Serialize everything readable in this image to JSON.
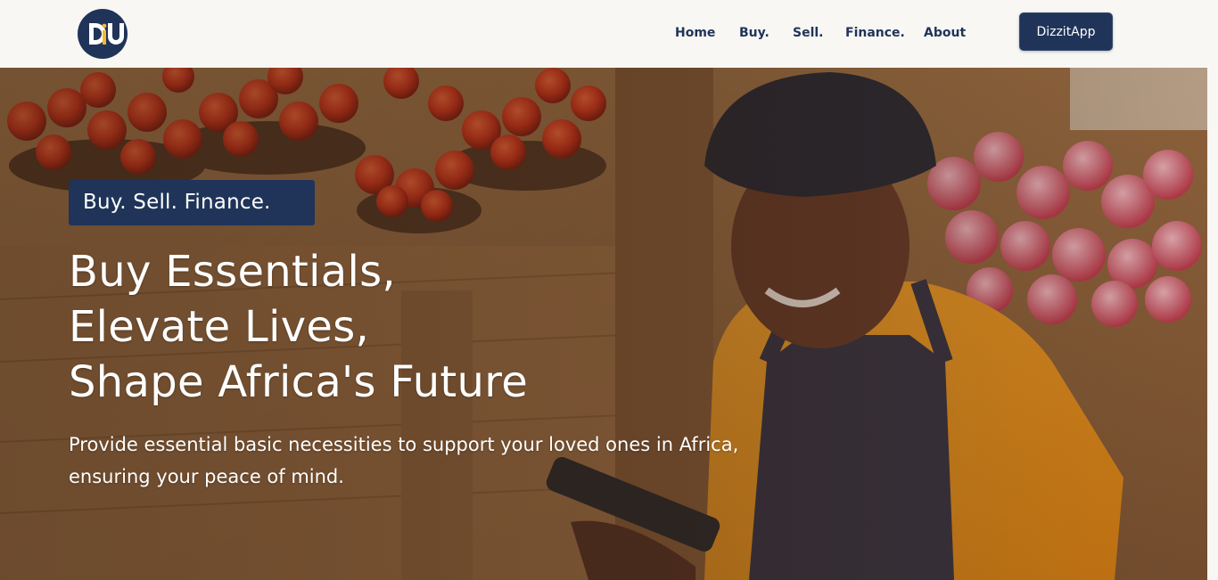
{
  "brand": {
    "logo_letters": "DU",
    "primary_color": "#1f3458",
    "accent_color": "#f5b82e"
  },
  "nav": {
    "items": [
      {
        "label": "Home"
      },
      {
        "label": "Buy."
      },
      {
        "label": "Sell."
      },
      {
        "label": "Finance."
      },
      {
        "label": "About"
      }
    ],
    "app_button_label": "DizzitApp"
  },
  "hero": {
    "tagline": "Buy. Sell. Finance.",
    "headline_lines": [
      "Buy Essentials,",
      "Elevate Lives,",
      "Shape Africa's Future"
    ],
    "subtext": "Provide essential basic necessities to support your loved ones in Africa, ensuring your peace of mind.",
    "image_icon": "market-vendor-photo"
  }
}
